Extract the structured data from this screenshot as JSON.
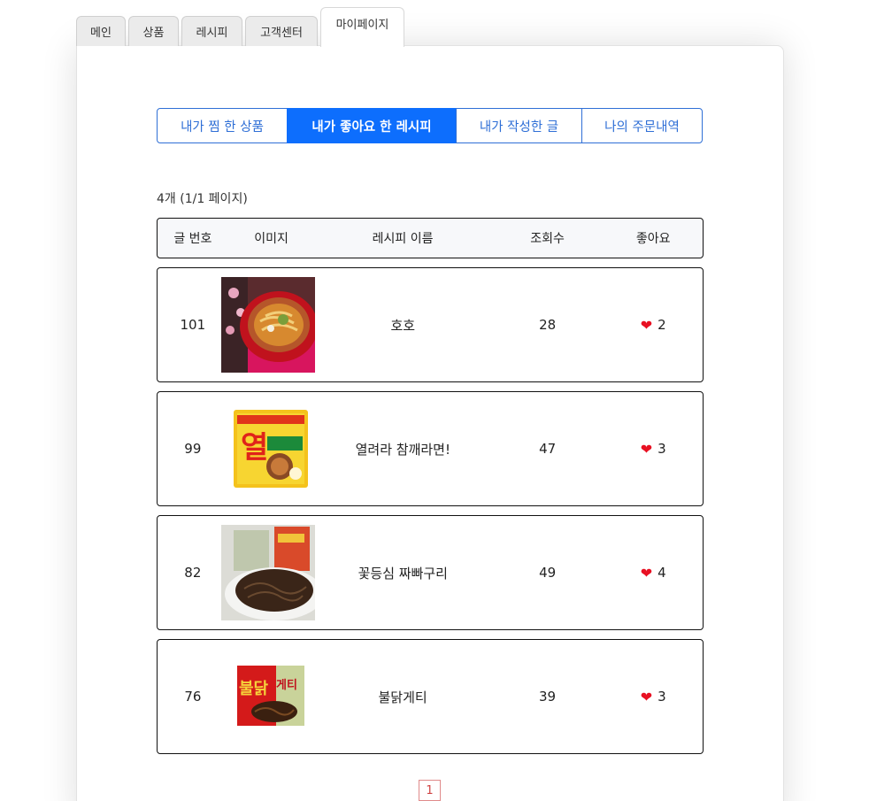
{
  "top_tabs": [
    {
      "label": "메인"
    },
    {
      "label": "상품"
    },
    {
      "label": "레시피"
    },
    {
      "label": "고객센터"
    },
    {
      "label": "마이페이지",
      "active": true
    }
  ],
  "sub_tabs": [
    {
      "label": "내가 찜 한 상품"
    },
    {
      "label": "내가 좋아요 한 레시피",
      "active": true
    },
    {
      "label": "내가 작성한 글"
    },
    {
      "label": "나의 주문내역"
    }
  ],
  "count_text": "4개 (1/1 페이지)",
  "table": {
    "headers": [
      "글 번호",
      "이미지",
      "레시피 이름",
      "조회수",
      "좋아요"
    ],
    "rows": [
      {
        "no": "101",
        "name": "호호",
        "views": "28",
        "likes": "2",
        "image": "ramen-bowl-photo"
      },
      {
        "no": "99",
        "name": "열려라 참깨라면!",
        "views": "47",
        "likes": "3",
        "image": "sesame-ramen-package"
      },
      {
        "no": "82",
        "name": "꽃등심 짜빠구리",
        "views": "49",
        "likes": "4",
        "image": "chapaguri-plate-photo"
      },
      {
        "no": "76",
        "name": "불닭게티",
        "views": "39",
        "likes": "3",
        "image": "buldak-getti-package"
      }
    ]
  },
  "like_icon": "heart-icon",
  "pagination": {
    "current": "1"
  },
  "colors": {
    "accent": "#0d6efd",
    "heart": "#e81123",
    "pager": "#d04444"
  }
}
